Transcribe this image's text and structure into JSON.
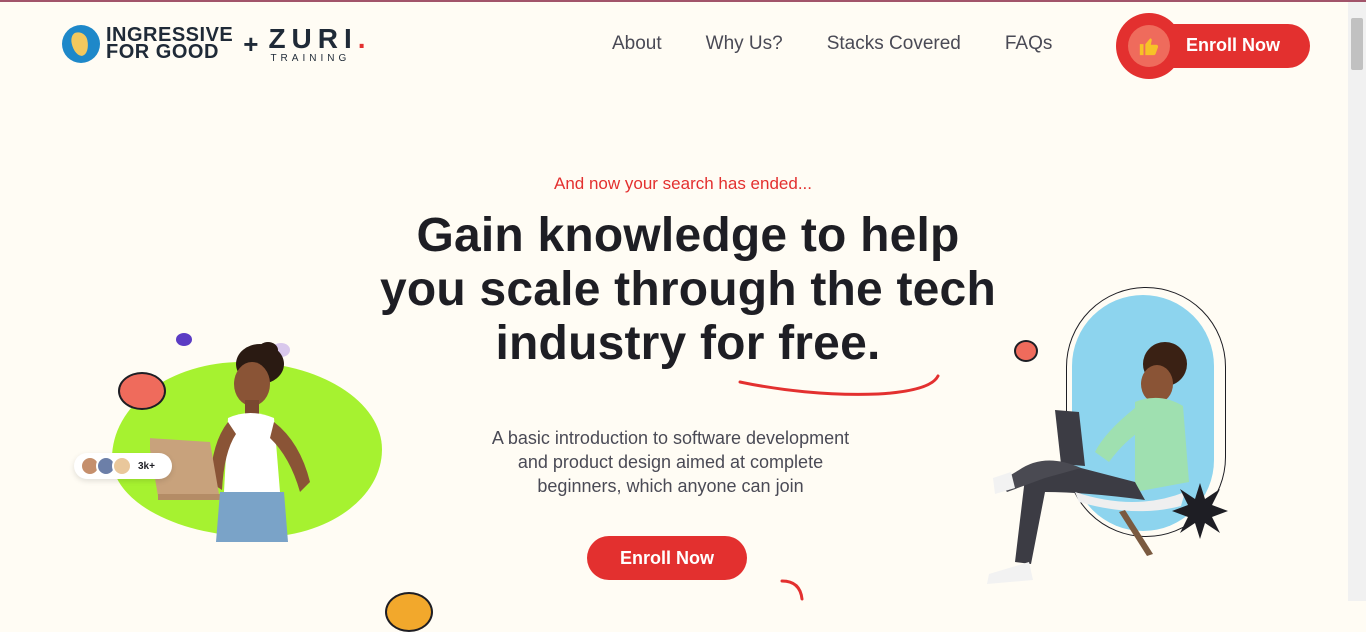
{
  "brand": {
    "ingressive_line1": "INGRESSIVE",
    "ingressive_line2": "FOR GOOD",
    "plus": "+",
    "zuri": "ZURI",
    "zuri_dot": ".",
    "zuri_sub": "TRAINING"
  },
  "nav": {
    "items": [
      "About",
      "Why Us?",
      "Stacks Covered",
      "FAQs"
    ]
  },
  "header_cta": {
    "label": "Enroll Now",
    "icon": "thumbs-up-icon"
  },
  "hero": {
    "tagline": "And now your search has ended...",
    "headline_line1": "Gain knowledge to help",
    "headline_line2": "you scale through the tech",
    "headline_line3": "industry for free.",
    "subtext_line1": "A basic introduction to software development",
    "subtext_line2": "and product design aimed at complete",
    "subtext_line3": "beginners, which anyone can join",
    "cta_label": "Enroll Now"
  },
  "social_proof": {
    "count": "3k+"
  },
  "colors": {
    "accent": "#e3302f",
    "background": "#fffcf4",
    "green_blob": "#a6f230",
    "blue_capsule": "#8dd4ee"
  }
}
